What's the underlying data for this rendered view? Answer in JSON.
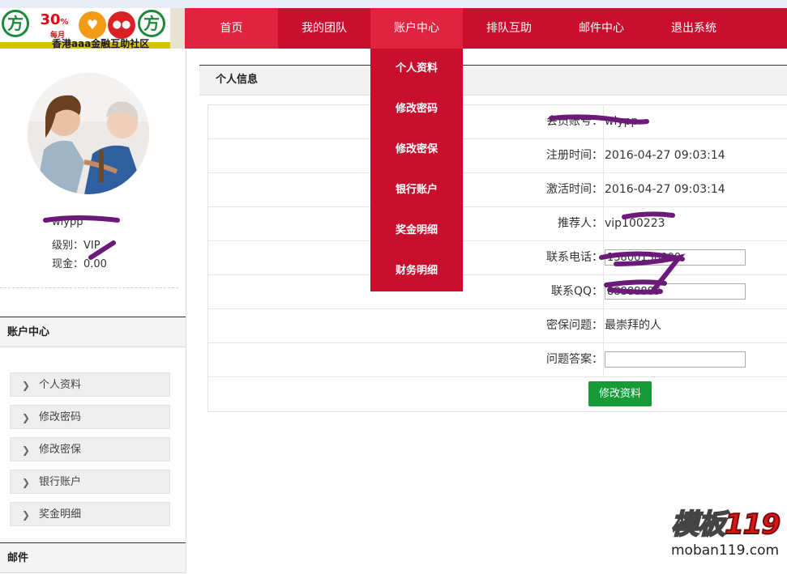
{
  "header": {
    "logo_brand": "香港aaa金融互助社区",
    "logo_percent": "30",
    "logo_percent_unit": "%",
    "logo_period": "每月",
    "nav": [
      {
        "label": "首页"
      },
      {
        "label": "我的团队"
      },
      {
        "label": "账户中心"
      },
      {
        "label": "排队互助"
      },
      {
        "label": "邮件中心"
      },
      {
        "label": "退出系统"
      }
    ],
    "active_nav": "账户中心"
  },
  "dropdown": {
    "items": [
      {
        "label": "个人资料"
      },
      {
        "label": "修改密码"
      },
      {
        "label": "修改密保"
      },
      {
        "label": "银行账户"
      },
      {
        "label": "奖金明细"
      },
      {
        "label": "财务明细"
      }
    ]
  },
  "sidebar": {
    "username": "wlypp",
    "level": "级别：VIP",
    "cash": "现金：0.00",
    "section_account": "账户中心",
    "links": [
      {
        "label": "个人资料"
      },
      {
        "label": "修改密码"
      },
      {
        "label": "修改密保"
      },
      {
        "label": "银行账户"
      },
      {
        "label": "奖金明细"
      }
    ],
    "section_mail": "邮件"
  },
  "main": {
    "panel_title": "个人信息",
    "rows": [
      {
        "label": "会员账号：",
        "value": "wlypp"
      },
      {
        "label": "注册时间：",
        "value": "2016-04-27 09:03:14"
      },
      {
        "label": "激活时间：",
        "value": "2016-04-27 09:03:14"
      },
      {
        "label": "推荐人：",
        "value": "vip100223"
      }
    ],
    "phone_label": "联系电话：",
    "phone_value": "13800138000",
    "qq_label": "联系QQ：",
    "qq_value": "88888889",
    "security_question_label": "密保问题：",
    "security_question_value": "最崇拜的人",
    "answer_label": "问题答案：",
    "answer_value": "",
    "submit_label": "修改资料"
  },
  "watermark": {
    "logo_text": "模板",
    "logo_number": "119",
    "url": "moban119.com"
  }
}
